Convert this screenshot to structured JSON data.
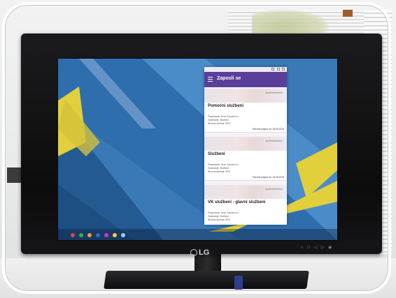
{
  "scene": {
    "brand": "LG",
    "tv_buttons": "○ □ ◁ ▷ ◉"
  },
  "app": {
    "title": "Zaposli se",
    "cards": [
      {
        "tag": "ispiti/nekretnine",
        "title": "Pomoćni službeni",
        "line1": "Poslodavac: Hvar Turizam d.o.",
        "line2": "Zanimanje: Službeni",
        "line3": "Stručna sprema: SSS",
        "date": "Rok/rok prijave do: 16.06.2019"
      },
      {
        "tag": "ispiti/nekretnine",
        "title": "Službeni",
        "line1": "Poslodavac: Hvar Turizam d.o.",
        "line2": "Zanimanje: Službeni",
        "line3": "Stručna sprema: SSS",
        "date": "Rok/rok prijave do: 16.06.2019"
      },
      {
        "tag": "ispiti/nekretnine",
        "title": "VK službeni - glavni službeni",
        "line1": "Poslodavac: Hvar Turizam d.o.",
        "line2": "Zanimanje: Službeni",
        "line3": "Stručna sprema: SSS",
        "date": ""
      }
    ]
  },
  "colors": {
    "app_bar": "#5a3f9a",
    "wallpaper_blue": "#2b6aa5",
    "wallpaper_yellow": "#e1cf3c"
  }
}
